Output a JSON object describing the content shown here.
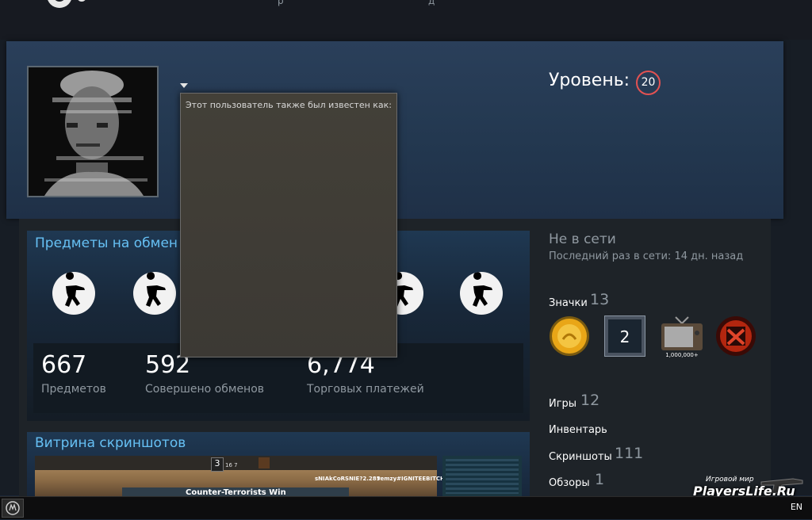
{
  "header": {
    "nav_fragments": [
      "р",
      "д"
    ]
  },
  "profile": {
    "level_label": "Уровень:",
    "level_value": "20",
    "aliases_title": "Этот пользователь также был известен как:"
  },
  "trade_showcase": {
    "title": "Предметы на обмен",
    "stats": [
      {
        "value": "667",
        "label": "Предметов"
      },
      {
        "value": "592",
        "label": "Совершено обменов"
      },
      {
        "value": "6,774",
        "label": "Торговых платежей"
      }
    ]
  },
  "screenshot_showcase": {
    "title": "Витрина скриншотов",
    "hud_number": "3",
    "hud_score": "16   7",
    "killfeed_left": "sNIAkCoRSNIE?2.285",
    "killfeed_right": "remzy#IGNITEEBITCH-",
    "banner": "Counter-Terrorists Win"
  },
  "sidebar": {
    "status": "Не в сети",
    "last_online": "Последний раз в сети: 14 дн. назад",
    "badges_label": "Значки",
    "badges_count": "13",
    "badge_number": "2",
    "badge_tv_caption": "1,000,000+",
    "links": [
      {
        "label": "Игры",
        "count": "12"
      },
      {
        "label": "Инвентарь",
        "count": ""
      },
      {
        "label": "Скриншоты",
        "count": "111"
      },
      {
        "label": "Обзоры",
        "count": "1"
      }
    ]
  },
  "taskbar": {
    "language": "EN"
  },
  "watermark": {
    "top": "Игровой мир",
    "main": "PlayersLife.Ru"
  },
  "colors": {
    "accent": "#66c0f4",
    "level_ring": "#e35252"
  }
}
